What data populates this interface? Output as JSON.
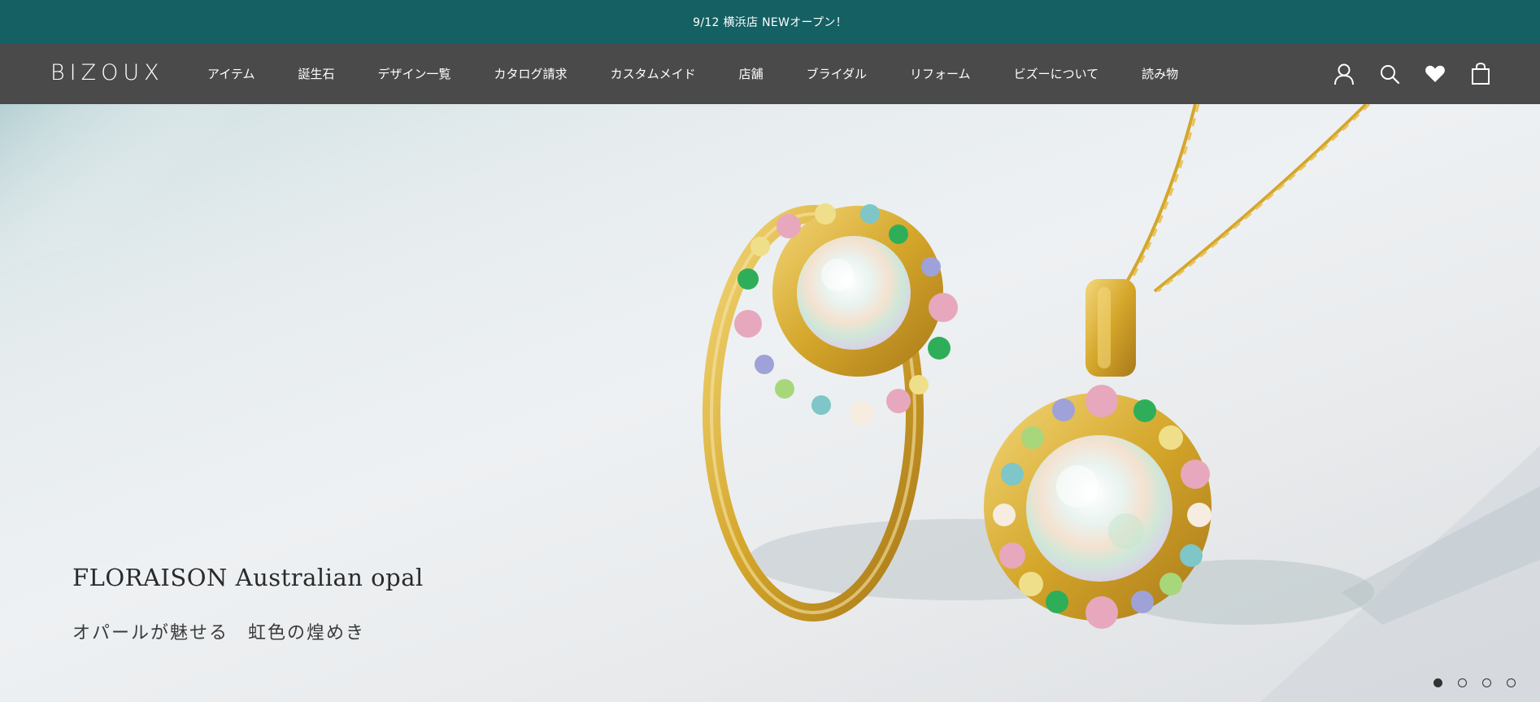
{
  "announcement": {
    "text": "9/12 横浜店 NEWオープン！"
  },
  "header": {
    "logo": "BIZOUX",
    "nav": [
      {
        "label": "アイテム"
      },
      {
        "label": "誕生石"
      },
      {
        "label": "デザイン一覧"
      },
      {
        "label": "カタログ請求"
      },
      {
        "label": "カスタムメイド"
      },
      {
        "label": "店舗"
      },
      {
        "label": "ブライダル"
      },
      {
        "label": "リフォーム"
      },
      {
        "label": "ビズーについて"
      },
      {
        "label": "読み物"
      }
    ],
    "icons": [
      "account-icon",
      "search-icon",
      "heart-icon",
      "bag-icon"
    ]
  },
  "hero": {
    "title": "FLORAISON Australian opal",
    "subtitle": "オパールが魅せる　虹色の煌めき",
    "slides": {
      "count": 4,
      "active": 1
    }
  },
  "colors": {
    "announcement_bg": "#146063",
    "header_bg": "#4a4a4a",
    "gold": "#d4a62a"
  }
}
